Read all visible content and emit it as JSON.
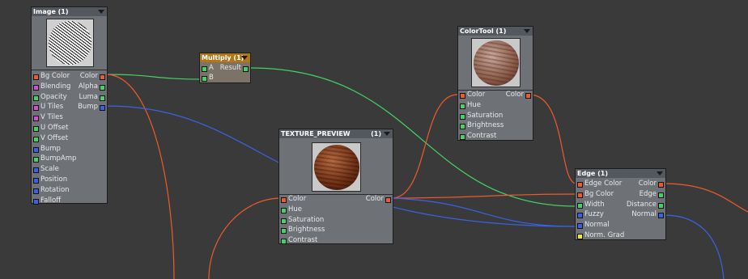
{
  "nodes": {
    "image": {
      "title": "Image (1)",
      "inputs": [
        "Bg Color",
        "Blending",
        "Opacity",
        "U Tiles",
        "V Tiles",
        "U Offset",
        "V Offset",
        "Bump",
        "BumpAmp",
        "Scale",
        "Position",
        "Rotation",
        "Falloff"
      ],
      "outputs": [
        "Color",
        "Alpha",
        "Luma",
        "Bump"
      ]
    },
    "multiply": {
      "title": "Multiply (1)",
      "inputs": [
        "A",
        "B"
      ],
      "outputs": [
        "Result"
      ]
    },
    "texture_preview": {
      "title": "TEXTURE_PREVIEW",
      "count": "(1)",
      "inputs": [
        "Color",
        "Hue",
        "Saturation",
        "Brightness",
        "Contrast"
      ],
      "outputs": [
        "Color"
      ]
    },
    "colortool": {
      "title": "ColorTool (1)",
      "inputs": [
        "Color",
        "Hue",
        "Saturation",
        "Brightness",
        "Contrast"
      ],
      "outputs": [
        "Color"
      ]
    },
    "edge": {
      "title": "Edge (1)",
      "inputs": [
        "Edge Color",
        "Bg Color",
        "Width",
        "Fuzzy",
        "Normal",
        "Norm. Grad"
      ],
      "outputs": [
        "Color",
        "Edge",
        "Distance",
        "Normal"
      ]
    }
  },
  "colors": {
    "background": "#3a3a3a",
    "color_pin": "#ee5a2a",
    "scalar_pin": "#44d266",
    "integer_pin": "#d64fcf",
    "vector_pin": "#3b62e6",
    "function_pin": "#f2e640"
  }
}
